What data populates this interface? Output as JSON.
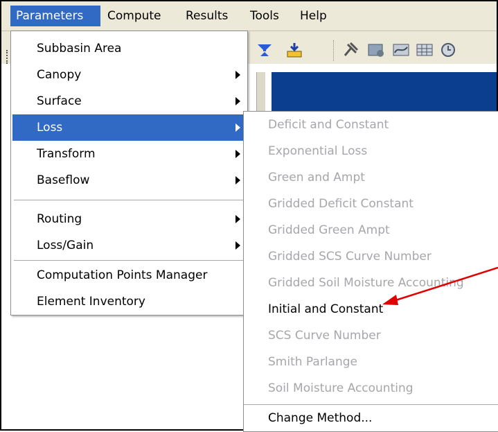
{
  "menubar": {
    "items": [
      "Parameters",
      "Compute",
      "Results",
      "Tools",
      "Help"
    ]
  },
  "parameters_menu": {
    "items": [
      {
        "label": "Subbasin Area",
        "submenu": false
      },
      {
        "label": "Canopy",
        "submenu": true
      },
      {
        "label": "Surface",
        "submenu": true
      },
      {
        "label": "Loss",
        "submenu": true,
        "active": true
      },
      {
        "label": "Transform",
        "submenu": true
      },
      {
        "label": "Baseflow",
        "submenu": true
      },
      {
        "label": "Routing",
        "submenu": true
      },
      {
        "label": "Loss/Gain",
        "submenu": true
      },
      {
        "label": "Computation Points Manager",
        "submenu": false
      },
      {
        "label": "Element Inventory",
        "submenu": false
      }
    ]
  },
  "loss_submenu": {
    "items": [
      {
        "label": "Deficit and Constant",
        "enabled": false
      },
      {
        "label": "Exponential Loss",
        "enabled": false
      },
      {
        "label": "Green and Ampt",
        "enabled": false
      },
      {
        "label": "Gridded Deficit Constant",
        "enabled": false
      },
      {
        "label": "Gridded Green Ampt",
        "enabled": false
      },
      {
        "label": "Gridded SCS Curve Number",
        "enabled": false
      },
      {
        "label": "Gridded Soil Moisture Accounting",
        "enabled": false
      },
      {
        "label": "Initial and Constant",
        "enabled": true
      },
      {
        "label": "SCS Curve Number",
        "enabled": false
      },
      {
        "label": "Smith Parlange",
        "enabled": false
      },
      {
        "label": "Soil Moisture Accounting",
        "enabled": false
      },
      {
        "label": "Change Method...",
        "enabled": true
      }
    ]
  },
  "colors": {
    "menubar_bg": "#ece9d8",
    "highlight": "#316ac5",
    "disabled_text": "#a7a6aa",
    "annotation_arrow": "#e00000",
    "titlebar_blue": "#0c3e8f"
  }
}
